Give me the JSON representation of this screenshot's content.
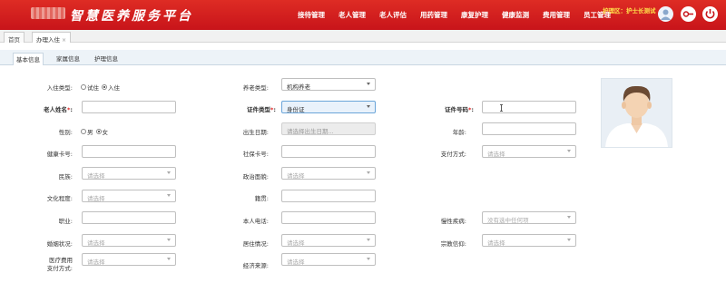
{
  "app": {
    "title": "智慧医养服务平台"
  },
  "nav": [
    "接待管理",
    "老人管理",
    "老人评估",
    "用药管理",
    "康复护理",
    "健康监测",
    "费用管理",
    "员工管理"
  ],
  "ward": {
    "label": "护理区：护士长测试"
  },
  "page_tabs": [
    {
      "label": "首页",
      "closable": false
    },
    {
      "label": "办理入住",
      "closable": true,
      "close": "×"
    }
  ],
  "sub_tabs": [
    "基本信息",
    "家属信息",
    "护理信息"
  ],
  "form": {
    "admission_type": {
      "label": "入住类型:",
      "options": [
        "试住",
        "入住"
      ],
      "selected": "入住"
    },
    "care_type": {
      "label": "养老类型:",
      "value": "机构养老"
    },
    "elder_name": {
      "label": "老人姓名",
      "req": "*",
      "colon": ":",
      "value": ""
    },
    "id_type": {
      "label": "证件类型",
      "req": "*",
      "colon": ":",
      "value": "身份证"
    },
    "id_number": {
      "label": "证件号码",
      "req": "*",
      "colon": ":",
      "value": ""
    },
    "gender": {
      "label": "性别:",
      "options": [
        "男",
        "女"
      ],
      "selected": "女"
    },
    "birth_date": {
      "label": "出生日期:",
      "placeholder": "请选择出生日期..."
    },
    "age": {
      "label": "年龄:",
      "value": ""
    },
    "health_card": {
      "label": "健康卡号:",
      "value": ""
    },
    "social_security": {
      "label": "社保卡号:",
      "value": ""
    },
    "payment_method": {
      "label": "支付方式:",
      "placeholder": "请选择"
    },
    "ethnicity": {
      "label": "民族:",
      "placeholder": "请选择"
    },
    "political_status": {
      "label": "政治面貌:",
      "placeholder": "请选择"
    },
    "education": {
      "label": "文化程度:",
      "placeholder": "请选择"
    },
    "native_place": {
      "label": "籍贯:",
      "value": ""
    },
    "occupation": {
      "label": "职业:",
      "value": ""
    },
    "phone": {
      "label": "本人电话:",
      "value": ""
    },
    "chronic_disease": {
      "label": "慢性疾病:",
      "placeholder": "没有选中任何项"
    },
    "marital_status": {
      "label": "婚姻状况:",
      "placeholder": "请选择"
    },
    "living_status": {
      "label": "居住情况:",
      "placeholder": "请选择"
    },
    "religion": {
      "label": "宗教信仰:",
      "placeholder": "请选择"
    },
    "medical_payment": {
      "label_line1": "医疗费用",
      "label_line2": "支付方式:",
      "placeholder": "请选择"
    },
    "economic_source": {
      "label": "经济来源:",
      "placeholder": "请选择"
    }
  },
  "colors": {
    "header_red": "#d0161c",
    "ward_yellow": "#ffe14a",
    "required_red": "#e02020",
    "subtab_bg": "#edf3f8"
  }
}
